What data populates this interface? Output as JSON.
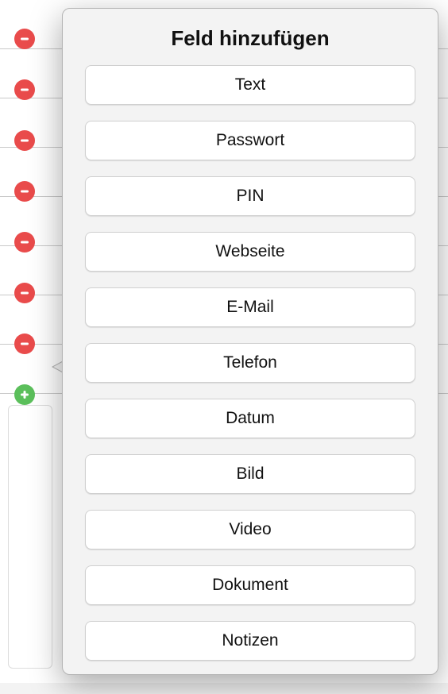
{
  "popover": {
    "title": "Feld hinzufügen",
    "options": [
      "Text",
      "Passwort",
      "PIN",
      "Webseite",
      "E-Mail",
      "Telefon",
      "Datum",
      "Bild",
      "Video",
      "Dokument",
      "Notizen"
    ]
  },
  "side": {
    "remove_icons": 7,
    "add_icons": 1
  },
  "rows": 8
}
